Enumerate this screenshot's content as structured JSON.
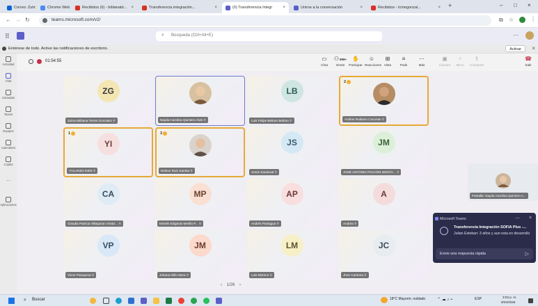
{
  "browser": {
    "tabs": [
      {
        "label": "Correo: Zulma Bibiana To...",
        "color": "#0a64d6",
        "active": false
      },
      {
        "label": "Chrome Web Store",
        "color": "#4a8af4",
        "active": false
      },
      {
        "label": "Recibidos (6) - biblanatd...",
        "color": "#d93025",
        "active": false
      },
      {
        "label": "Transferencia integración...",
        "color": "#d93025",
        "active": false
      },
      {
        "label": "(II) Transferencia Integr",
        "color": "#5b5fc7",
        "active": true
      },
      {
        "label": "Unirse a la conversación",
        "color": "#5b5fc7",
        "active": false
      },
      {
        "label": "Recibidos - tcmegonzal...",
        "color": "#d93025",
        "active": false
      }
    ],
    "url": "teams.microsoft.com/v2/"
  },
  "teams": {
    "search_placeholder": "Búsqueda (Ctrl+Alt+E)",
    "notification": "Entérese de todo. Active las notificaciones de escritorio.",
    "activate_label": "Activar",
    "timer": "01:54:55"
  },
  "rail": [
    {
      "label": "Actividad"
    },
    {
      "label": "Chat"
    },
    {
      "label": "Llamadas"
    },
    {
      "label": "Teams"
    },
    {
      "label": "Equipos"
    },
    {
      "label": "Calendario"
    },
    {
      "label": "Copilot"
    },
    {
      "label": "..."
    },
    {
      "label": "Aplicaciones"
    }
  ],
  "toolbar": [
    {
      "label": "Chat",
      "icon": "chat-icon",
      "glyph": "▭"
    },
    {
      "label": "Gente",
      "icon": "people-icon",
      "glyph": "⚇",
      "count": "999+"
    },
    {
      "label": "Participar",
      "icon": "raise-hand-icon",
      "glyph": "✋"
    },
    {
      "label": "Reacciones",
      "icon": "emoji-icon",
      "glyph": "☺"
    },
    {
      "label": "Vista",
      "icon": "view-icon",
      "glyph": "⊞"
    },
    {
      "label": "Pods",
      "icon": "pods-icon",
      "glyph": "≡"
    },
    {
      "label": "Más",
      "icon": "more-icon",
      "glyph": "⋯"
    },
    {
      "label": "Cámara",
      "icon": "camera-icon",
      "glyph": "▣",
      "dim": true
    },
    {
      "label": "Micro",
      "icon": "mic-icon",
      "glyph": "♂",
      "dim": true
    },
    {
      "label": "Compartir",
      "icon": "share-icon",
      "glyph": "⇪",
      "dim": true
    },
    {
      "label": "Salir",
      "icon": "leave-icon",
      "glyph": "☎"
    }
  ],
  "participants": [
    {
      "initials": "ZG",
      "name": "Zulma Bibiana Torres Gonzalez",
      "bg": "#f3e6b3",
      "fg": "#3a3a3a"
    },
    {
      "initials": "",
      "name": "Nayda Carolina Quintero Alvis",
      "photo": true,
      "active": true
    },
    {
      "initials": "LB",
      "name": "Luis Felipe Beltran Beltran",
      "bg": "#cfe5e1",
      "fg": "#2d5b53"
    },
    {
      "initials": "",
      "name": "Andres Rubiano Cucunan",
      "photo": true,
      "hand": "2"
    },
    {
      "initials": "YI",
      "name": "YOLANDA INÉS",
      "bg": "#f6e0df",
      "fg": "#6b3b3a",
      "hand": "1"
    },
    {
      "initials": "",
      "name": "Nelson Ruiz Gamba",
      "photo": true,
      "hand": "3"
    },
    {
      "initials": "JS",
      "name": "Jesús Sandoval",
      "bg": "#d5e9f5",
      "fg": "#3a5a6e"
    },
    {
      "initials": "JM",
      "name": "JOSÉ ANTONIO PACHÓN MONTA...",
      "bg": "#dcf0d9",
      "fg": "#3c6039"
    },
    {
      "initials": "CA",
      "name": "Claudia Patricia Villaquiran Aristiz...",
      "bg": "#e0ecf5",
      "fg": "#35495a"
    },
    {
      "initials": "MP",
      "name": "Moisés Edgardo Merillo P...",
      "bg": "#fae0d2",
      "fg": "#6b4230"
    },
    {
      "initials": "AP",
      "name": "Andrés Paniagua",
      "bg": "#f8dede",
      "fg": "#6f3737"
    },
    {
      "initials": "A",
      "name": "Andrea",
      "bg": "#f5dcdc",
      "fg": "#6b3a3a"
    },
    {
      "initials": "VP",
      "name": "Victor Panqueva",
      "bg": "#d9e8f6",
      "fg": "#344e66"
    },
    {
      "initials": "JM",
      "name": "Johana Niño Mora",
      "bg": "#fbd9cc",
      "fg": "#6c3d2c"
    },
    {
      "initials": "LM",
      "name": "Luis Moreno",
      "bg": "#f7efc6",
      "fg": "#5c5330"
    },
    {
      "initials": "JC",
      "name": "Jhon Cardona",
      "bg": "#e6ecef",
      "fg": "#3c4a55"
    }
  ],
  "pager": "1/26",
  "side_video": {
    "name": "Pantalla: Nayda Carolina Quintero A..."
  },
  "toast": {
    "header": "Microsoft Teams",
    "title": "Transferencia Integración SOFIA Plus -...",
    "body": "Julian Esteban: 3 años y aun esta en desarrollo",
    "reply": "Envíe una respuesta rápida"
  },
  "taskbar": {
    "search": "Buscar",
    "weather": "18°C Mayorm. nublado",
    "lang": "ESP",
    "time": "3:03 p. m.",
    "date": "9/04/2026"
  }
}
